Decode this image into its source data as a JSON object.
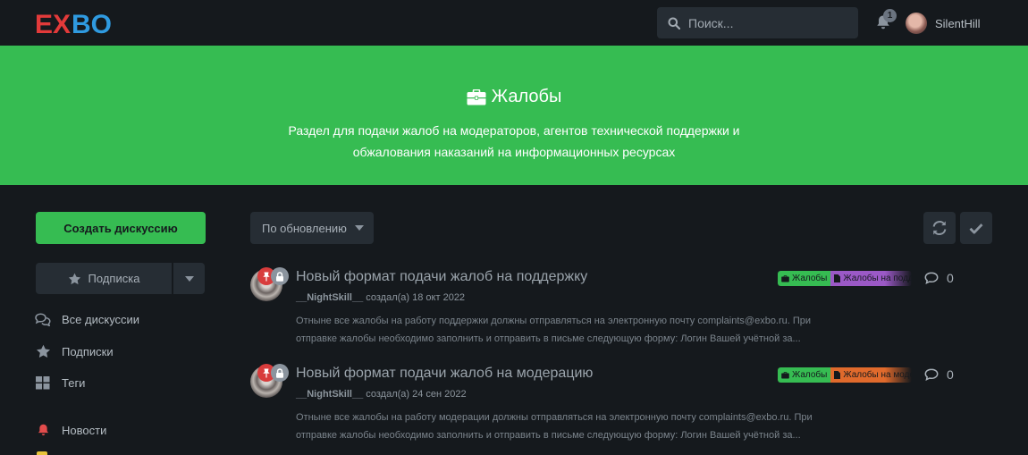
{
  "header": {
    "logo_text": "EXBO",
    "search_placeholder": "Поиск...",
    "notifications_count": "1",
    "username": "SilentHill"
  },
  "hero": {
    "title": "Жалобы",
    "description_line1": "Раздел для подачи жалоб на модераторов, агентов технической поддержки и",
    "description_line2": "обжалования наказаний на информационных ресурсах",
    "color": "#36bc52"
  },
  "sidebar": {
    "create_label": "Создать дискуссию",
    "subscription_label": "Подписка",
    "nav": [
      {
        "label": "Все дискуссии",
        "icon": "comments-icon"
      },
      {
        "label": "Подписки",
        "icon": "star-icon"
      },
      {
        "label": "Теги",
        "icon": "grid-icon"
      },
      {
        "label": "Новости",
        "icon": "bell-icon"
      }
    ]
  },
  "toolbar": {
    "sort_label": "По обновлению"
  },
  "discussions": [
    {
      "title": "Новый формат подачи жалоб на поддержку",
      "author": "__NightSkill__",
      "created": "создал(а) 18 окт 2022",
      "excerpt_line1": "Отныне все жалобы на работу поддержки должны отправляться на электронную почту complaints@exbo.ru. При",
      "excerpt_line2": "отправке жалобы необходимо заполнить и отправить в письме следующую форму: Логин Вашей учётной за...",
      "tags": [
        {
          "label": "Жалобы",
          "color": "#36bc52",
          "icon": "briefcase-icon"
        },
        {
          "label": "Жалобы на поддержку",
          "color": "#9b59c6",
          "icon": "file-icon"
        }
      ],
      "replies": "0"
    },
    {
      "title": "Новый формат подачи жалоб на модерацию",
      "author": "__NightSkill__",
      "created": "создал(а) 24 сен 2022",
      "excerpt_line1": "Отныне все жалобы на работу модерации должны отправляться на электронную почту complaints@exbo.ru. При",
      "excerpt_line2": "отправке жалобы необходимо заполнить и отправить в письме следующую форму: Логин Вашей учётной за...",
      "tags": [
        {
          "label": "Жалобы",
          "color": "#36bc52",
          "icon": "briefcase-icon"
        },
        {
          "label": "Жалобы на модерацию",
          "color": "#e06a2c",
          "icon": "file-icon"
        }
      ],
      "replies": "0"
    }
  ]
}
